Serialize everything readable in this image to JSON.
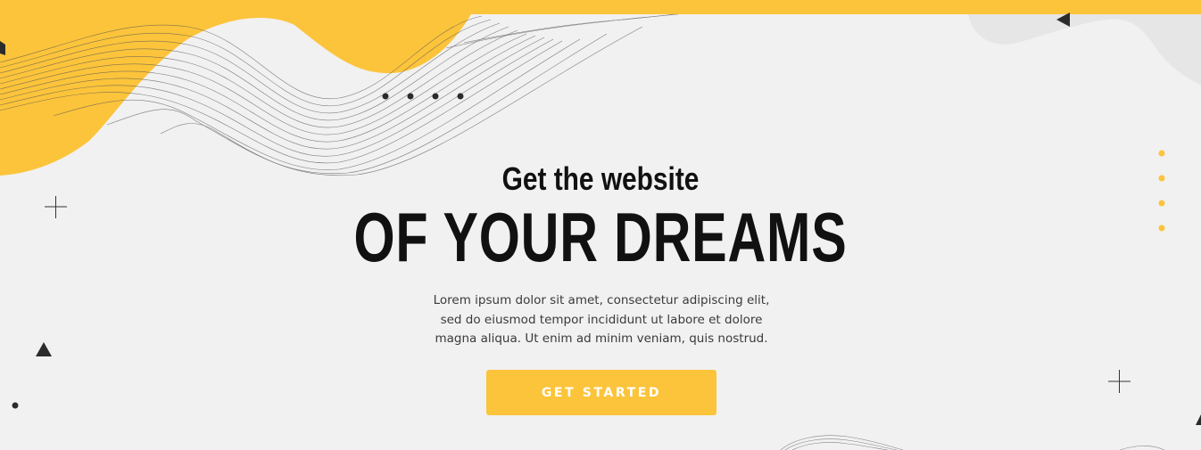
{
  "hero": {
    "subtitle": "Get the website",
    "headline": "OF YOUR DREAMS",
    "description": "Lorem ipsum dolor sit amet, consectetur adipiscing elit, sed do eiusmod tempor incididunt ut labore et dolore magna aliqua. Ut enim ad minim veniam, quis nostrud.",
    "cta_label": "GET STARTED"
  },
  "colors": {
    "accent": "#fcc43b",
    "background": "#f1f1f1",
    "text_dark": "#111111"
  }
}
